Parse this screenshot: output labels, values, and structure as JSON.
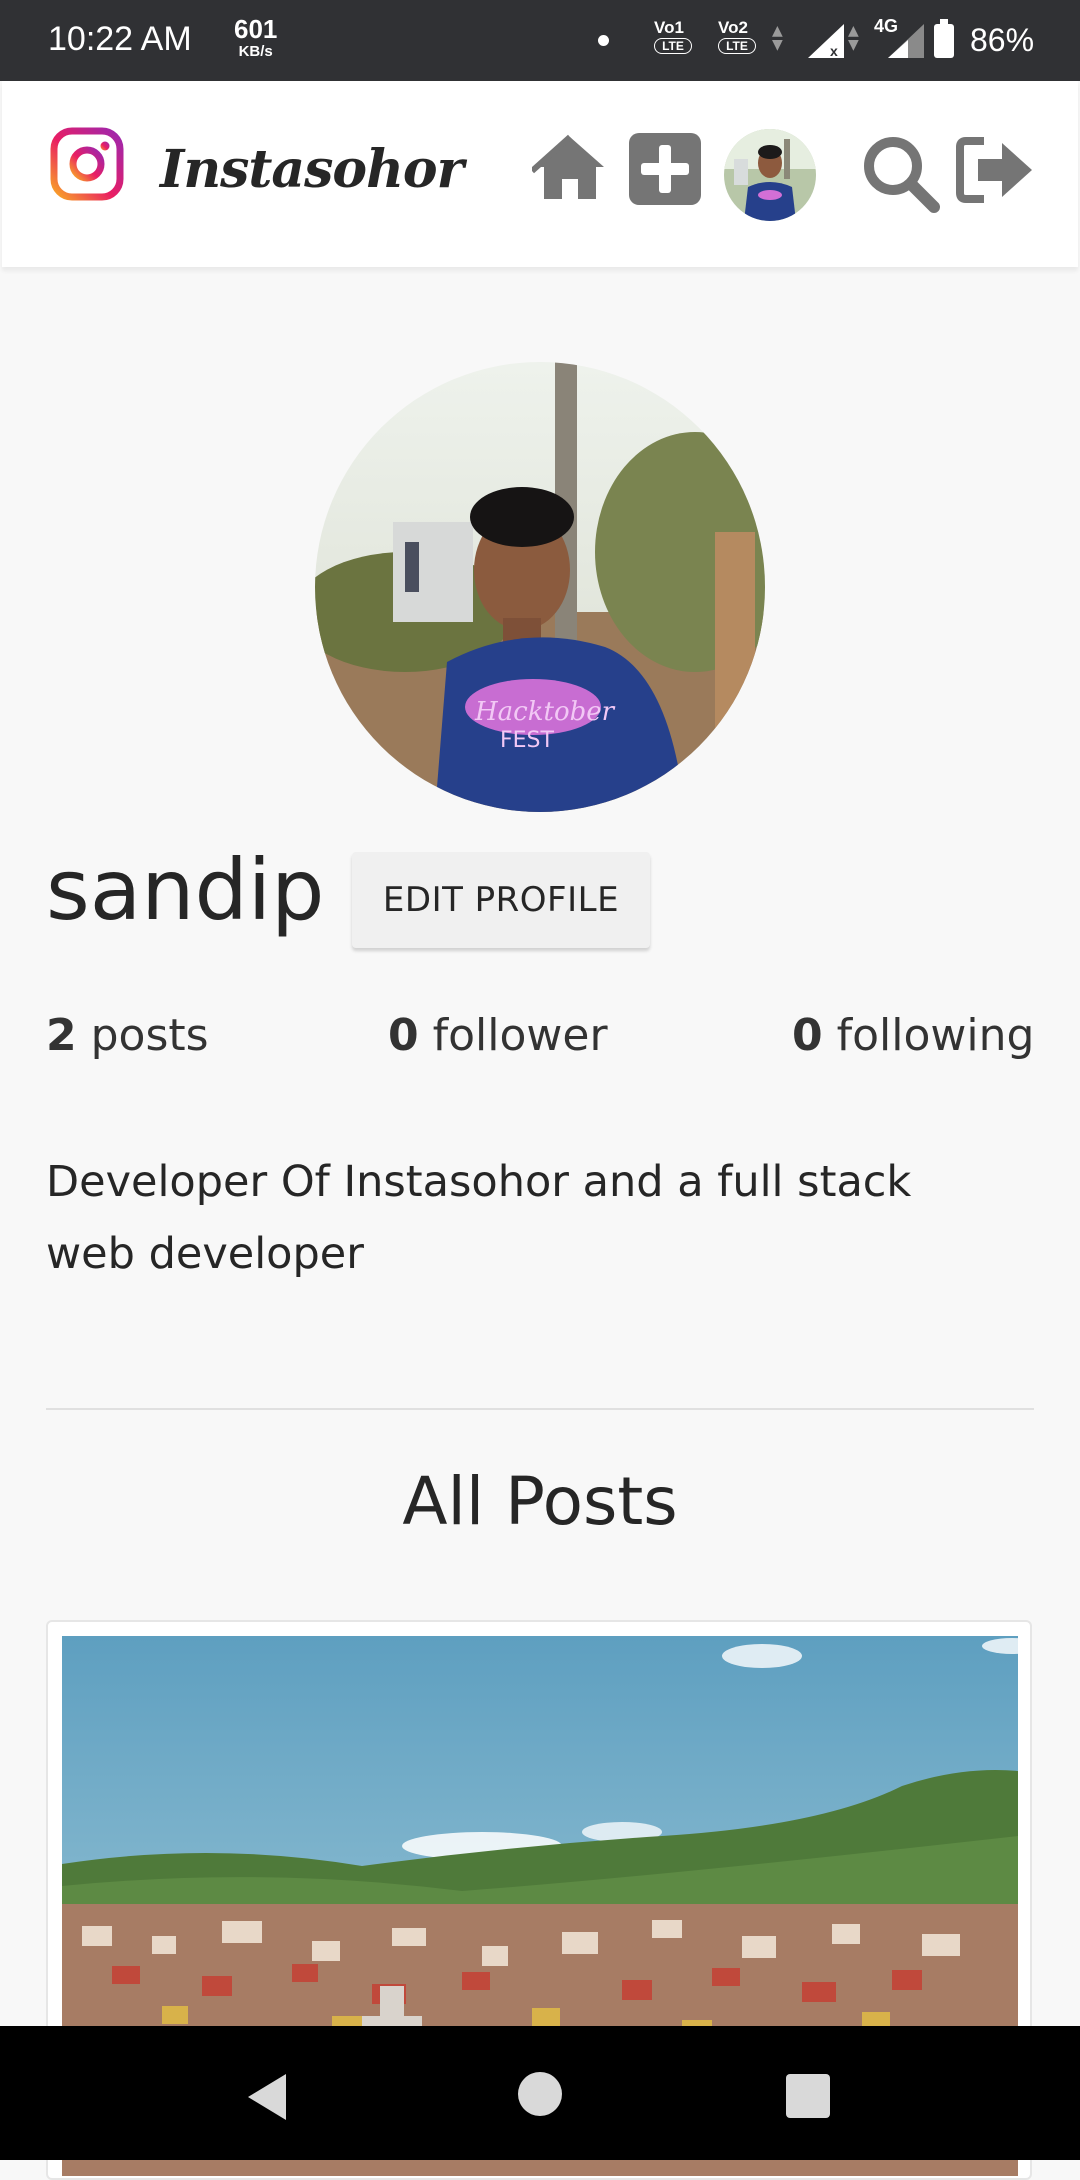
{
  "status_bar": {
    "time": "10:22 AM",
    "speed_value": "601",
    "speed_unit": "KB/s",
    "sim1_label": "Vo1",
    "sim1_lte": "LTE",
    "sim2_label": "Vo2",
    "sim2_lte": "LTE",
    "network": "4G",
    "battery": "86%"
  },
  "app": {
    "brand": "Instasohor",
    "icons": [
      "instagram-logo-icon",
      "home-icon",
      "add-post-icon",
      "avatar",
      "search-icon",
      "logout-icon"
    ]
  },
  "profile": {
    "username": "sandip",
    "edit_label": "EDIT PROFILE",
    "posts_count": "2",
    "posts_label": "posts",
    "follower_count": "0",
    "follower_label": "follower",
    "following_count": "0",
    "following_label": "following",
    "bio": "Developer Of Instasohor and a full stack web developer"
  },
  "posts_section": {
    "title": "All Posts"
  },
  "colors": {
    "status_bar": "#303134",
    "icon_gray": "#757575",
    "background": "#f8f8f8"
  }
}
